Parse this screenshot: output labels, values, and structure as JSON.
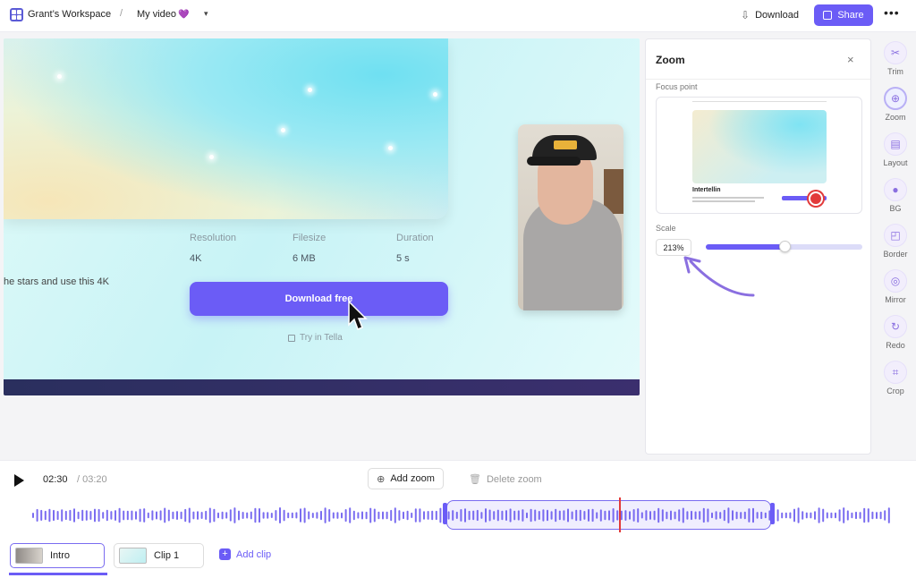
{
  "header": {
    "workspace_name": "Grant’s Workspace",
    "separator": "/",
    "video_name": "My video",
    "video_emoji": "💜",
    "download_label": "Download",
    "share_label": "Share",
    "more_label": "•••"
  },
  "video": {
    "meta": [
      {
        "label": "Resolution",
        "value": "4K"
      },
      {
        "label": "Filesize",
        "value": "6 MB"
      },
      {
        "label": "Duration",
        "value": "5 s"
      }
    ],
    "partial_text": "he stars and use this 4K",
    "download_button_label": "Download free",
    "try_link_label": "Try in Tella"
  },
  "zoom_panel": {
    "title": "Zoom",
    "close_label": "×",
    "focus_point_label": "Focus point",
    "preview_title": "Intertellin",
    "scale_label": "Scale",
    "scale_value": "213%",
    "scale_fraction": 0.5
  },
  "tools": [
    {
      "label": "Trim",
      "icon": "trim-icon",
      "glyph": "✂"
    },
    {
      "label": "Zoom",
      "icon": "zoom-icon",
      "glyph": "⊕"
    },
    {
      "label": "Layout",
      "icon": "layout-icon",
      "glyph": "▤"
    },
    {
      "label": "BG",
      "icon": "background-icon",
      "glyph": "●"
    },
    {
      "label": "Border",
      "icon": "border-icon",
      "glyph": "◰"
    },
    {
      "label": "Mirror",
      "icon": "mirror-icon",
      "glyph": "◎"
    },
    {
      "label": "Redo",
      "icon": "redo-icon",
      "glyph": "↻"
    },
    {
      "label": "Crop",
      "icon": "crop-icon",
      "glyph": "⌗"
    }
  ],
  "timeline": {
    "current_time": "02:30",
    "total_time": "/ 03:20",
    "add_zoom_label": "Add zoom",
    "delete_zoom_label": "Delete zoom",
    "clips": [
      {
        "label": "Intro",
        "selected": true
      },
      {
        "label": "Clip 1",
        "selected": false
      }
    ],
    "add_clip_label": "Add clip"
  },
  "colors": {
    "accent": "#6b5cf6",
    "playhead": "#e23a3a",
    "wave": "#7a6cf0"
  }
}
